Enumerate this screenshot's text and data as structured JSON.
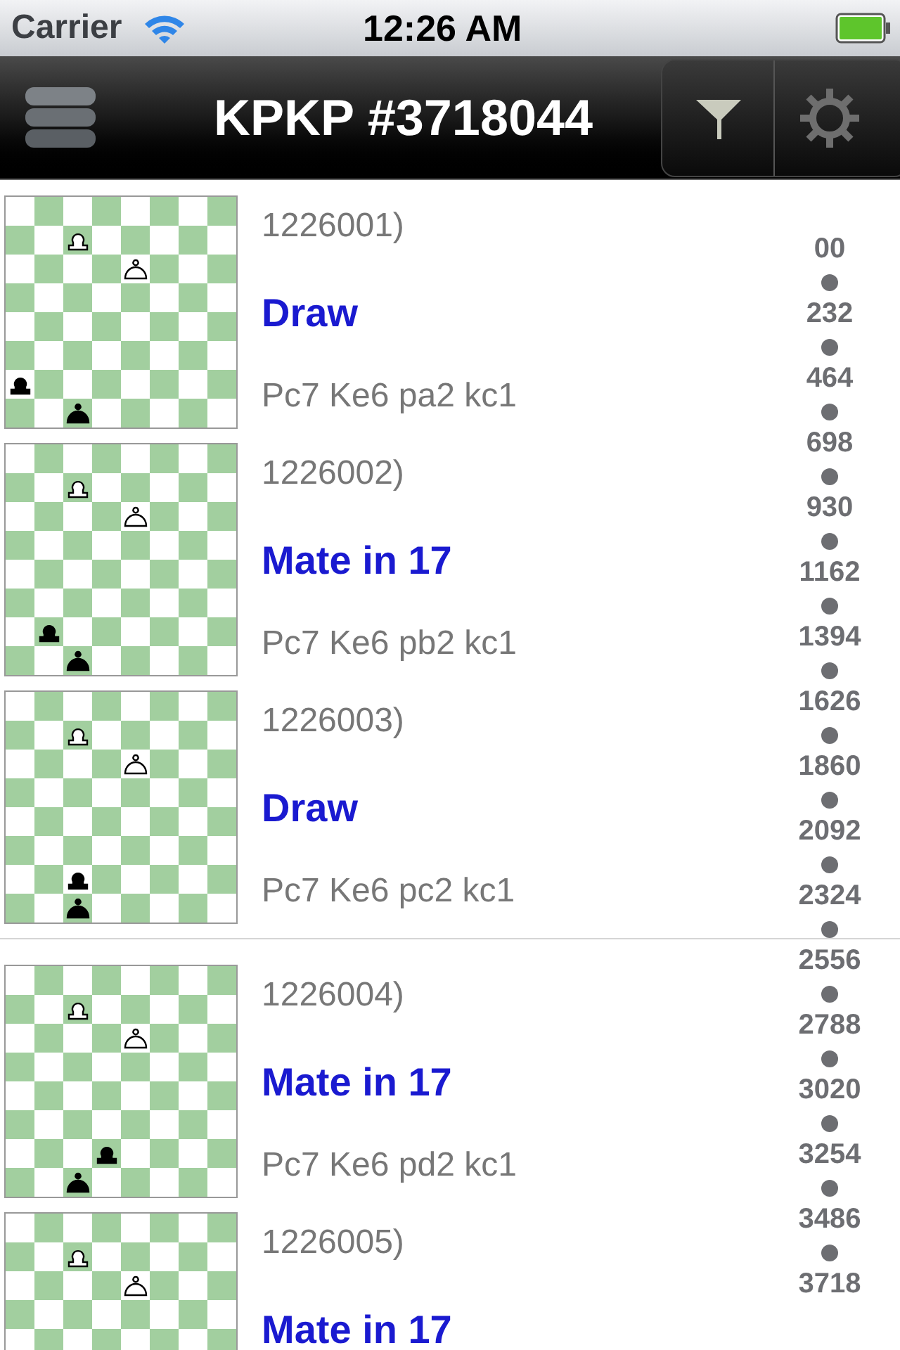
{
  "status_bar": {
    "carrier": "Carrier",
    "time": "12:26 AM"
  },
  "nav_bar": {
    "title": "KPKP #3718044"
  },
  "sections": [
    {
      "rows": [
        {
          "id": "1226001)",
          "result": "Draw",
          "position": "Pc7 Ke6 pa2 kc1",
          "board": [
            [
              {
                "kind": "empty"
              },
              {
                "kind": "empty"
              },
              {
                "kind": "empty"
              },
              {
                "kind": "empty"
              },
              {
                "kind": "empty"
              },
              {
                "kind": "empty"
              },
              {
                "kind": "empty"
              },
              {
                "kind": "empty"
              }
            ],
            [
              {
                "kind": "empty"
              },
              {
                "kind": "empty"
              },
              {
                "kind": "pawn",
                "white": true
              },
              {
                "kind": "empty"
              },
              {
                "kind": "empty"
              },
              {
                "kind": "empty"
              },
              {
                "kind": "empty"
              },
              {
                "kind": "empty"
              }
            ],
            [
              {
                "kind": "empty"
              },
              {
                "kind": "empty"
              },
              {
                "kind": "empty"
              },
              {
                "kind": "empty"
              },
              {
                "kind": "king",
                "white": true
              },
              {
                "kind": "empty"
              },
              {
                "kind": "empty"
              },
              {
                "kind": "empty"
              }
            ],
            [
              {
                "kind": "empty"
              },
              {
                "kind": "empty"
              },
              {
                "kind": "empty"
              },
              {
                "kind": "empty"
              },
              {
                "kind": "empty"
              },
              {
                "kind": "empty"
              },
              {
                "kind": "empty"
              },
              {
                "kind": "empty"
              }
            ],
            [
              {
                "kind": "empty"
              },
              {
                "kind": "empty"
              },
              {
                "kind": "empty"
              },
              {
                "kind": "empty"
              },
              {
                "kind": "empty"
              },
              {
                "kind": "empty"
              },
              {
                "kind": "empty"
              },
              {
                "kind": "empty"
              }
            ],
            [
              {
                "kind": "empty"
              },
              {
                "kind": "empty"
              },
              {
                "kind": "empty"
              },
              {
                "kind": "empty"
              },
              {
                "kind": "empty"
              },
              {
                "kind": "empty"
              },
              {
                "kind": "empty"
              },
              {
                "kind": "empty"
              }
            ],
            [
              {
                "kind": "pawn",
                "white": false
              },
              {
                "kind": "empty"
              },
              {
                "kind": "empty"
              },
              {
                "kind": "empty"
              },
              {
                "kind": "empty"
              },
              {
                "kind": "empty"
              },
              {
                "kind": "empty"
              },
              {
                "kind": "empty"
              }
            ],
            [
              {
                "kind": "empty"
              },
              {
                "kind": "empty"
              },
              {
                "kind": "king",
                "white": false
              },
              {
                "kind": "empty"
              },
              {
                "kind": "empty"
              },
              {
                "kind": "empty"
              },
              {
                "kind": "empty"
              },
              {
                "kind": "empty"
              }
            ]
          ]
        },
        {
          "id": "1226002)",
          "result": "Mate in 17",
          "position": "Pc7 Ke6 pb2 kc1",
          "board": [
            [
              {
                "kind": "empty"
              },
              {
                "kind": "empty"
              },
              {
                "kind": "empty"
              },
              {
                "kind": "empty"
              },
              {
                "kind": "empty"
              },
              {
                "kind": "empty"
              },
              {
                "kind": "empty"
              },
              {
                "kind": "empty"
              }
            ],
            [
              {
                "kind": "empty"
              },
              {
                "kind": "empty"
              },
              {
                "kind": "pawn",
                "white": true
              },
              {
                "kind": "empty"
              },
              {
                "kind": "empty"
              },
              {
                "kind": "empty"
              },
              {
                "kind": "empty"
              },
              {
                "kind": "empty"
              }
            ],
            [
              {
                "kind": "empty"
              },
              {
                "kind": "empty"
              },
              {
                "kind": "empty"
              },
              {
                "kind": "empty"
              },
              {
                "kind": "king",
                "white": true
              },
              {
                "kind": "empty"
              },
              {
                "kind": "empty"
              },
              {
                "kind": "empty"
              }
            ],
            [
              {
                "kind": "empty"
              },
              {
                "kind": "empty"
              },
              {
                "kind": "empty"
              },
              {
                "kind": "empty"
              },
              {
                "kind": "empty"
              },
              {
                "kind": "empty"
              },
              {
                "kind": "empty"
              },
              {
                "kind": "empty"
              }
            ],
            [
              {
                "kind": "empty"
              },
              {
                "kind": "empty"
              },
              {
                "kind": "empty"
              },
              {
                "kind": "empty"
              },
              {
                "kind": "empty"
              },
              {
                "kind": "empty"
              },
              {
                "kind": "empty"
              },
              {
                "kind": "empty"
              }
            ],
            [
              {
                "kind": "empty"
              },
              {
                "kind": "empty"
              },
              {
                "kind": "empty"
              },
              {
                "kind": "empty"
              },
              {
                "kind": "empty"
              },
              {
                "kind": "empty"
              },
              {
                "kind": "empty"
              },
              {
                "kind": "empty"
              }
            ],
            [
              {
                "kind": "empty"
              },
              {
                "kind": "pawn",
                "white": false
              },
              {
                "kind": "empty"
              },
              {
                "kind": "empty"
              },
              {
                "kind": "empty"
              },
              {
                "kind": "empty"
              },
              {
                "kind": "empty"
              },
              {
                "kind": "empty"
              }
            ],
            [
              {
                "kind": "empty"
              },
              {
                "kind": "empty"
              },
              {
                "kind": "king",
                "white": false
              },
              {
                "kind": "empty"
              },
              {
                "kind": "empty"
              },
              {
                "kind": "empty"
              },
              {
                "kind": "empty"
              },
              {
                "kind": "empty"
              }
            ]
          ]
        },
        {
          "id": "1226003)",
          "result": "Draw",
          "position": "Pc7 Ke6 pc2 kc1",
          "board": [
            [
              {
                "kind": "empty"
              },
              {
                "kind": "empty"
              },
              {
                "kind": "empty"
              },
              {
                "kind": "empty"
              },
              {
                "kind": "empty"
              },
              {
                "kind": "empty"
              },
              {
                "kind": "empty"
              },
              {
                "kind": "empty"
              }
            ],
            [
              {
                "kind": "empty"
              },
              {
                "kind": "empty"
              },
              {
                "kind": "pawn",
                "white": true
              },
              {
                "kind": "empty"
              },
              {
                "kind": "empty"
              },
              {
                "kind": "empty"
              },
              {
                "kind": "empty"
              },
              {
                "kind": "empty"
              }
            ],
            [
              {
                "kind": "empty"
              },
              {
                "kind": "empty"
              },
              {
                "kind": "empty"
              },
              {
                "kind": "empty"
              },
              {
                "kind": "king",
                "white": true
              },
              {
                "kind": "empty"
              },
              {
                "kind": "empty"
              },
              {
                "kind": "empty"
              }
            ],
            [
              {
                "kind": "empty"
              },
              {
                "kind": "empty"
              },
              {
                "kind": "empty"
              },
              {
                "kind": "empty"
              },
              {
                "kind": "empty"
              },
              {
                "kind": "empty"
              },
              {
                "kind": "empty"
              },
              {
                "kind": "empty"
              }
            ],
            [
              {
                "kind": "empty"
              },
              {
                "kind": "empty"
              },
              {
                "kind": "empty"
              },
              {
                "kind": "empty"
              },
              {
                "kind": "empty"
              },
              {
                "kind": "empty"
              },
              {
                "kind": "empty"
              },
              {
                "kind": "empty"
              }
            ],
            [
              {
                "kind": "empty"
              },
              {
                "kind": "empty"
              },
              {
                "kind": "empty"
              },
              {
                "kind": "empty"
              },
              {
                "kind": "empty"
              },
              {
                "kind": "empty"
              },
              {
                "kind": "empty"
              },
              {
                "kind": "empty"
              }
            ],
            [
              {
                "kind": "empty"
              },
              {
                "kind": "empty"
              },
              {
                "kind": "pawn",
                "white": false
              },
              {
                "kind": "empty"
              },
              {
                "kind": "empty"
              },
              {
                "kind": "empty"
              },
              {
                "kind": "empty"
              },
              {
                "kind": "empty"
              }
            ],
            [
              {
                "kind": "empty"
              },
              {
                "kind": "empty"
              },
              {
                "kind": "king",
                "white": false
              },
              {
                "kind": "empty"
              },
              {
                "kind": "empty"
              },
              {
                "kind": "empty"
              },
              {
                "kind": "empty"
              },
              {
                "kind": "empty"
              }
            ]
          ]
        }
      ]
    },
    {
      "rows": [
        {
          "id": "1226004)",
          "result": "Mate in 17",
          "position": "Pc7 Ke6 pd2 kc1",
          "board": [
            [
              {
                "kind": "empty"
              },
              {
                "kind": "empty"
              },
              {
                "kind": "empty"
              },
              {
                "kind": "empty"
              },
              {
                "kind": "empty"
              },
              {
                "kind": "empty"
              },
              {
                "kind": "empty"
              },
              {
                "kind": "empty"
              }
            ],
            [
              {
                "kind": "empty"
              },
              {
                "kind": "empty"
              },
              {
                "kind": "pawn",
                "white": true
              },
              {
                "kind": "empty"
              },
              {
                "kind": "empty"
              },
              {
                "kind": "empty"
              },
              {
                "kind": "empty"
              },
              {
                "kind": "empty"
              }
            ],
            [
              {
                "kind": "empty"
              },
              {
                "kind": "empty"
              },
              {
                "kind": "empty"
              },
              {
                "kind": "empty"
              },
              {
                "kind": "king",
                "white": true
              },
              {
                "kind": "empty"
              },
              {
                "kind": "empty"
              },
              {
                "kind": "empty"
              }
            ],
            [
              {
                "kind": "empty"
              },
              {
                "kind": "empty"
              },
              {
                "kind": "empty"
              },
              {
                "kind": "empty"
              },
              {
                "kind": "empty"
              },
              {
                "kind": "empty"
              },
              {
                "kind": "empty"
              },
              {
                "kind": "empty"
              }
            ],
            [
              {
                "kind": "empty"
              },
              {
                "kind": "empty"
              },
              {
                "kind": "empty"
              },
              {
                "kind": "empty"
              },
              {
                "kind": "empty"
              },
              {
                "kind": "empty"
              },
              {
                "kind": "empty"
              },
              {
                "kind": "empty"
              }
            ],
            [
              {
                "kind": "empty"
              },
              {
                "kind": "empty"
              },
              {
                "kind": "empty"
              },
              {
                "kind": "empty"
              },
              {
                "kind": "empty"
              },
              {
                "kind": "empty"
              },
              {
                "kind": "empty"
              },
              {
                "kind": "empty"
              }
            ],
            [
              {
                "kind": "empty"
              },
              {
                "kind": "empty"
              },
              {
                "kind": "empty"
              },
              {
                "kind": "pawn",
                "white": false
              },
              {
                "kind": "empty"
              },
              {
                "kind": "empty"
              },
              {
                "kind": "empty"
              },
              {
                "kind": "empty"
              }
            ],
            [
              {
                "kind": "empty"
              },
              {
                "kind": "empty"
              },
              {
                "kind": "king",
                "white": false
              },
              {
                "kind": "empty"
              },
              {
                "kind": "empty"
              },
              {
                "kind": "empty"
              },
              {
                "kind": "empty"
              },
              {
                "kind": "empty"
              }
            ]
          ]
        },
        {
          "id": "1226005)",
          "result": "Mate in 17",
          "board": [
            [
              {
                "kind": "empty"
              },
              {
                "kind": "empty"
              },
              {
                "kind": "empty"
              },
              {
                "kind": "empty"
              },
              {
                "kind": "empty"
              },
              {
                "kind": "empty"
              },
              {
                "kind": "empty"
              },
              {
                "kind": "empty"
              }
            ],
            [
              {
                "kind": "empty"
              },
              {
                "kind": "empty"
              },
              {
                "kind": "pawn",
                "white": true
              },
              {
                "kind": "empty"
              },
              {
                "kind": "empty"
              },
              {
                "kind": "empty"
              },
              {
                "kind": "empty"
              },
              {
                "kind": "empty"
              }
            ],
            [
              {
                "kind": "empty"
              },
              {
                "kind": "empty"
              },
              {
                "kind": "empty"
              },
              {
                "kind": "empty"
              },
              {
                "kind": "king",
                "white": true
              },
              {
                "kind": "empty"
              },
              {
                "kind": "empty"
              },
              {
                "kind": "empty"
              }
            ],
            [
              {
                "kind": "empty"
              },
              {
                "kind": "empty"
              },
              {
                "kind": "empty"
              },
              {
                "kind": "empty"
              },
              {
                "kind": "empty"
              },
              {
                "kind": "empty"
              },
              {
                "kind": "empty"
              },
              {
                "kind": "empty"
              }
            ],
            [
              {
                "kind": "empty"
              },
              {
                "kind": "empty"
              },
              {
                "kind": "empty"
              },
              {
                "kind": "empty"
              },
              {
                "kind": "empty"
              },
              {
                "kind": "empty"
              },
              {
                "kind": "empty"
              },
              {
                "kind": "empty"
              }
            ]
          ]
        }
      ]
    }
  ],
  "section_index": [
    "00",
    "232",
    "464",
    "698",
    "930",
    "1162",
    "1394",
    "1626",
    "1860",
    "2092",
    "2324",
    "2556",
    "2788",
    "3020",
    "3254",
    "3486",
    "3718"
  ]
}
